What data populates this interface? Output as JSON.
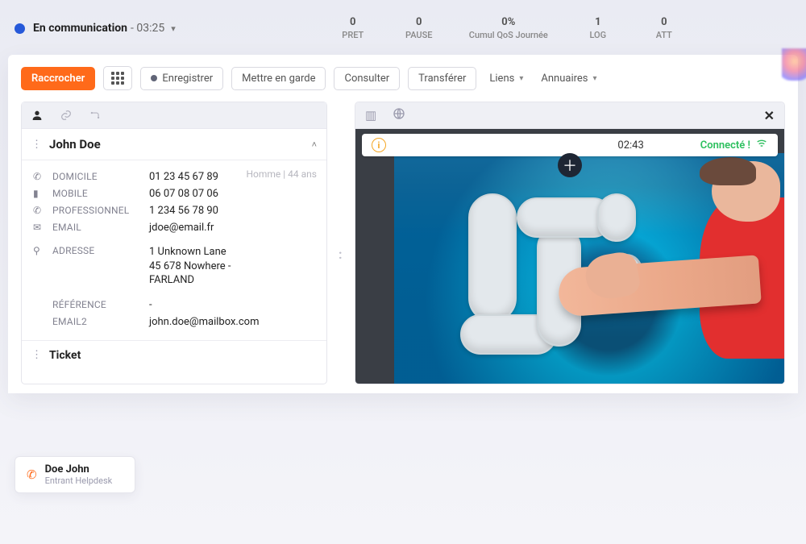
{
  "status": {
    "label": "En communication",
    "duration": "03:25"
  },
  "metrics": [
    {
      "value": "0",
      "label": "PRET"
    },
    {
      "value": "0",
      "label": "PAUSE"
    },
    {
      "value": "0%",
      "label": "Cumul QoS Journée"
    },
    {
      "value": "1",
      "label": "LOG"
    },
    {
      "value": "0",
      "label": "ATT"
    }
  ],
  "toolbar": {
    "hangup": "Raccrocher",
    "record": "Enregistrer",
    "hold": "Mettre en garde",
    "consult": "Consulter",
    "transfer": "Transférer",
    "links": "Liens",
    "directories": "Annuaires"
  },
  "contact": {
    "name": "John Doe",
    "meta": "Homme | 44 ans",
    "fields": {
      "home_lbl": "DOMICILE",
      "home_val": "01 23 45 67 89",
      "mobile_lbl": "MOBILE",
      "mobile_val": "06 07 08 07 06",
      "pro_lbl": "PROFESSIONNEL",
      "pro_val": "1 234 56 78 90",
      "email_lbl": "EMAIL",
      "email_val": "jdoe@email.fr",
      "addr_lbl": "ADRESSE",
      "addr_val": "1 Unknown Lane\n45 678 Nowhere -\nFARLAND",
      "ref_lbl": "RÉFÉRENCE",
      "ref_val": "-",
      "email2_lbl": "EMAIL2",
      "email2_val": "john.doe@mailbox.com"
    },
    "ticket_section": "Ticket"
  },
  "video": {
    "timer": "02:43",
    "connected": "Connecté !"
  },
  "call_chip": {
    "name": "Doe John",
    "sub": "Entrant Helpdesk"
  }
}
